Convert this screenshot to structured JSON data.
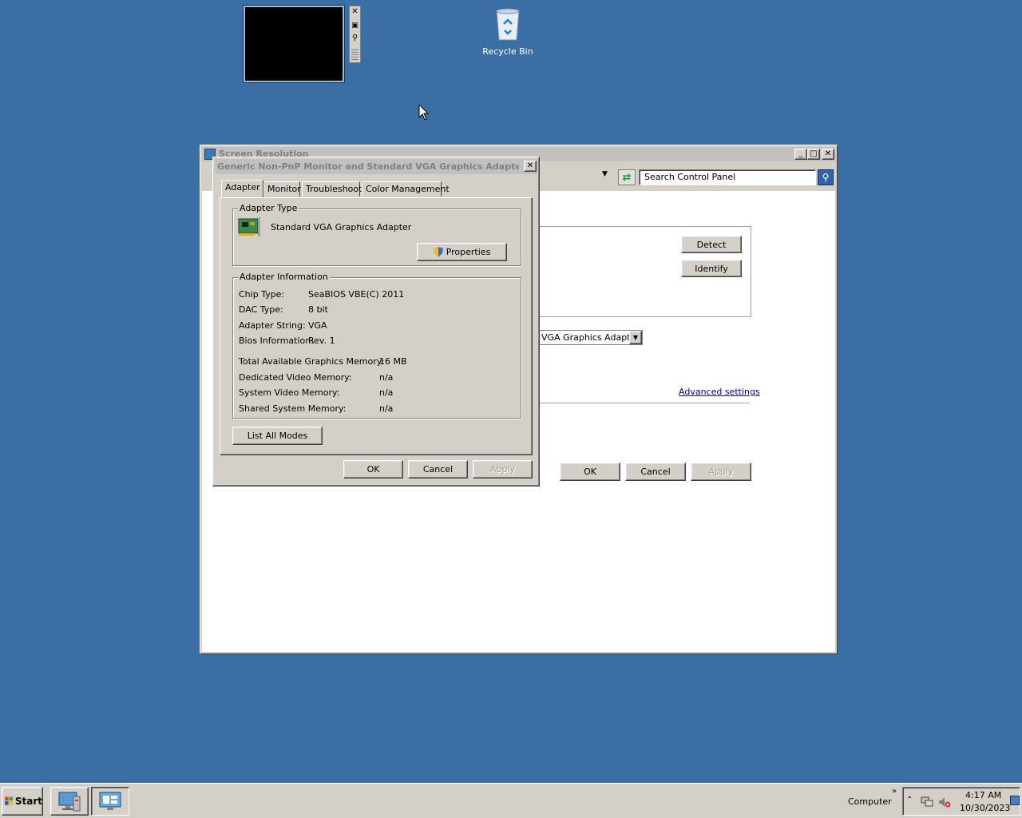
{
  "desktop": {
    "recycle_bin_label": "Recycle Bin"
  },
  "screen_resolution_window": {
    "title": "Screen Resolution",
    "search_placeholder": "Search Control Panel",
    "detect_label": "Detect",
    "identify_label": "Identify",
    "display_select_value": "VGA Graphics Adapter",
    "advanced_settings_label": "Advanced settings",
    "ok_label": "OK",
    "cancel_label": "Cancel",
    "apply_label": "Apply"
  },
  "properties_dialog": {
    "title": "Generic Non-PnP Monitor and Standard VGA Graphics Adapter Pro...",
    "tabs": [
      "Adapter",
      "Monitor",
      "Troubleshoot",
      "Color Management"
    ],
    "adapter_type_title": "Adapter Type",
    "adapter_name": "Standard VGA Graphics Adapter",
    "properties_label": "Properties",
    "adapter_info_title": "Adapter Information",
    "info_rows": [
      {
        "label": "Chip Type:",
        "value": "SeaBIOS VBE(C) 2011"
      },
      {
        "label": "DAC Type:",
        "value": "8 bit"
      },
      {
        "label": "Adapter String:",
        "value": "VGA"
      },
      {
        "label": "Bios Information:",
        "value": "Rev. 1"
      }
    ],
    "memory_rows": [
      {
        "label": "Total Available Graphics Memory:",
        "value": "16 MB"
      },
      {
        "label": "Dedicated Video Memory:",
        "value": "n/a"
      },
      {
        "label": "System Video Memory:",
        "value": "n/a"
      },
      {
        "label": "Shared System Memory:",
        "value": "n/a"
      }
    ],
    "list_all_modes_label": "List All Modes",
    "ok_label": "OK",
    "cancel_label": "Cancel",
    "apply_label": "Apply"
  },
  "taskbar": {
    "start_label": "Start",
    "computer_label": "Computer",
    "time": "4:17 AM",
    "date": "10/30/2023"
  },
  "colors": {
    "desktop": "#3a6ea5",
    "chrome": "#d4d0c8",
    "inactive_title": "#808080",
    "link": "#0000cc"
  }
}
